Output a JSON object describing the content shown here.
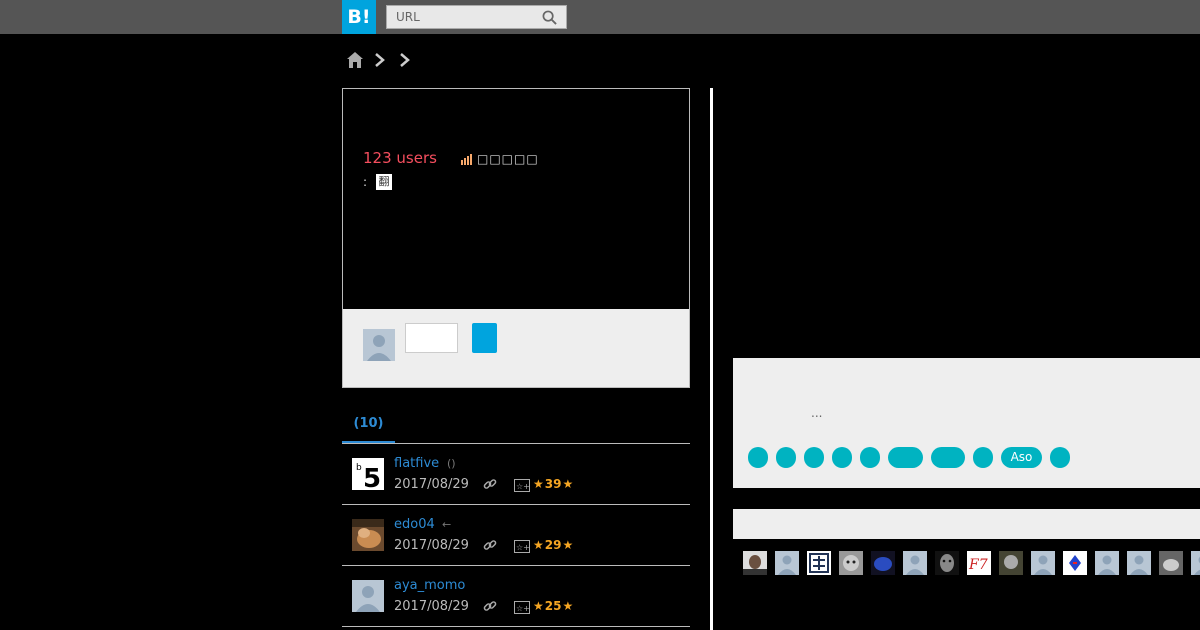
{
  "header": {
    "logo": "B!",
    "search_placeholder": "URL"
  },
  "entry": {
    "users": "123 users",
    "trend_text": "□□□□□",
    "meta_label": ":",
    "meta_badge": "翻"
  },
  "tabs": {
    "comments": "(10)"
  },
  "comments": [
    {
      "user": "flatfive",
      "extra": "()",
      "date": "2017/08/29",
      "stars": "39"
    },
    {
      "user": "edo04",
      "extra": "←",
      "date": "2017/08/29",
      "stars": "29"
    },
    {
      "user": "aya_momo",
      "extra": "",
      "date": "2017/08/29",
      "stars": "25"
    }
  ],
  "right_panel": {
    "ellipsis": "...",
    "tags": [
      "",
      "",
      "",
      "",
      "",
      "",
      "",
      "",
      "Aso",
      ""
    ]
  },
  "colors": {
    "brand": "#00a4de",
    "users_count": "#f54e5e",
    "tag": "#00b3c1",
    "star": "#f5a623",
    "link": "#2d8bd4"
  }
}
